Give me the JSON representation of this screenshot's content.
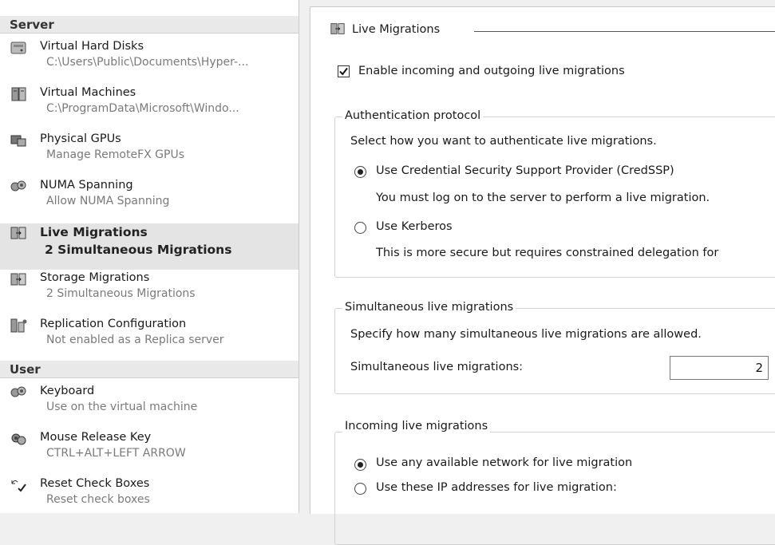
{
  "nav": {
    "server_header": "Server",
    "user_header": "User",
    "items": [
      {
        "icon": "hard-disk-icon",
        "title": "Virtual Hard Disks",
        "sub": "C:\\Users\\Public\\Documents\\Hyper-..."
      },
      {
        "icon": "virtual-machines-icon",
        "title": "Virtual Machines",
        "sub": "C:\\ProgramData\\Microsoft\\Windo..."
      },
      {
        "icon": "gpu-icon",
        "title": "Physical GPUs",
        "sub": "Manage RemoteFX GPUs"
      },
      {
        "icon": "numa-icon",
        "title": "NUMA Spanning",
        "sub": "Allow NUMA Spanning"
      },
      {
        "icon": "live-migration-icon",
        "title": "Live Migrations",
        "sub": "2 Simultaneous Migrations",
        "selected": true
      },
      {
        "icon": "storage-migration-icon",
        "title": "Storage Migrations",
        "sub": "2 Simultaneous Migrations"
      },
      {
        "icon": "replication-icon",
        "title": "Replication Configuration",
        "sub": "Not enabled as a Replica server"
      },
      {
        "icon": "keyboard-icon",
        "title": "Keyboard",
        "sub": "Use on the virtual machine"
      },
      {
        "icon": "mouse-release-key-icon",
        "title": "Mouse Release Key",
        "sub": "CTRL+ALT+LEFT ARROW"
      },
      {
        "icon": "reset-check-boxes-icon",
        "title": "Reset Check Boxes",
        "sub": "Reset check boxes"
      }
    ]
  },
  "details": {
    "title": "Live Migrations",
    "enable_label": "Enable incoming and outgoing live migrations",
    "enable_checked": true,
    "auth": {
      "legend": "Authentication protocol",
      "desc": "Select how you want to authenticate live migrations.",
      "credssp_label": "Use Credential Security Support Provider (CredSSP)",
      "credssp_note": "You must log on to the server to perform a live migration.",
      "kerberos_label": "Use Kerberos",
      "kerberos_note": "This is more secure but requires constrained delegation for",
      "selected": "credssp"
    },
    "simultaneous": {
      "legend": "Simultaneous live migrations",
      "desc": "Specify how many simultaneous live migrations are allowed.",
      "field_label": "Simultaneous live migrations:",
      "value": "2"
    },
    "incoming": {
      "legend": "Incoming live migrations",
      "any_network_label": "Use any available network for live migration",
      "ip_label": "Use these IP addresses for live migration:",
      "selected": "any"
    }
  }
}
